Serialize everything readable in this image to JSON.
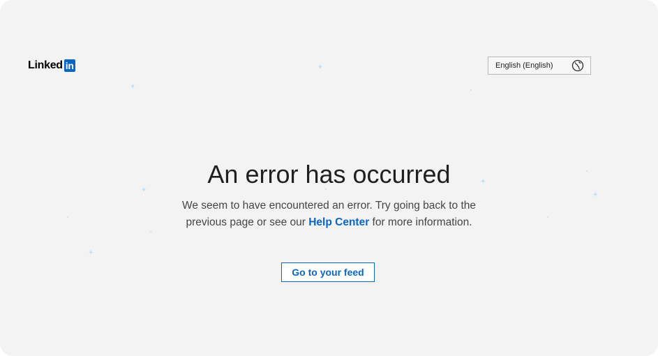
{
  "logo": {
    "text": "Linked",
    "box_text": "in",
    "brand_color": "#0a66c2"
  },
  "language_selector": {
    "selected": "English (English)",
    "icon": "globe-icon"
  },
  "error": {
    "title": "An error has occurred",
    "description_before": "We seem to have encountered an error. Try going back to the previous page or see our ",
    "help_link": "Help Center",
    "description_after": " for more information."
  },
  "actions": {
    "feed_button": "Go to your feed"
  },
  "decorations": {
    "sparkle_icon": "sparkle-icon",
    "color": "#bfe0f5"
  }
}
